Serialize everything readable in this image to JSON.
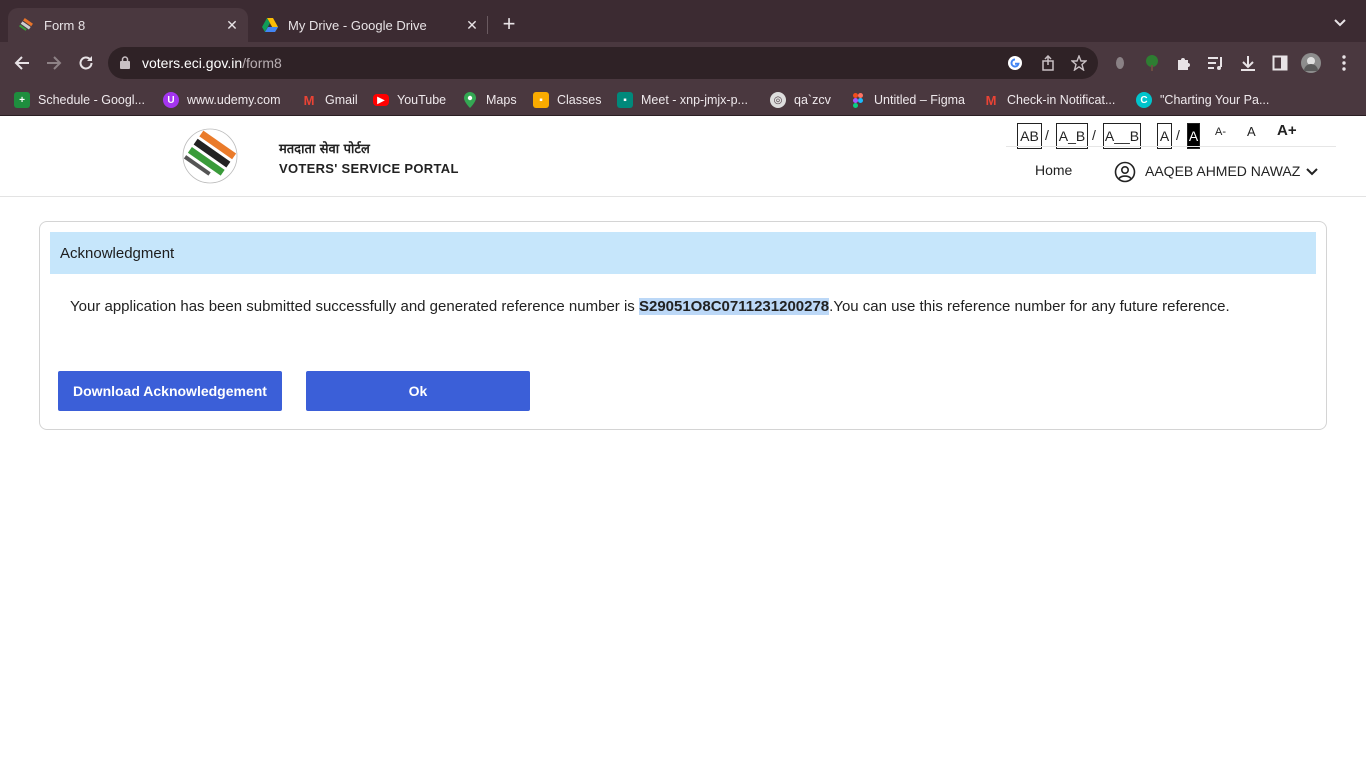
{
  "browser": {
    "tabs": [
      {
        "title": "Form 8",
        "favicon": "eci-favicon",
        "active": true
      },
      {
        "title": "My Drive - Google Drive",
        "favicon": "google-drive-icon",
        "active": false
      }
    ],
    "url": {
      "host": "voters.eci.gov.in",
      "path": "/form8"
    },
    "bookmarks": [
      {
        "label": "Schedule - Googl...",
        "icon": "google-sheets-icon",
        "color": "#1e8e3e"
      },
      {
        "label": "www.udemy.com",
        "icon": "udemy-icon",
        "color": "#a435f0"
      },
      {
        "label": "Gmail",
        "icon": "gmail-icon",
        "color": "#ea4335"
      },
      {
        "label": "YouTube",
        "icon": "youtube-icon",
        "color": "#ff0000"
      },
      {
        "label": "Maps",
        "icon": "maps-icon",
        "color": "#34a853"
      },
      {
        "label": "Classes",
        "icon": "classroom-icon",
        "color": "#f9ab00"
      },
      {
        "label": "Meet - xnp-jmjx-p...",
        "icon": "meet-icon",
        "color": "#00897b"
      },
      {
        "label": "qa`zcv",
        "icon": "globe-icon",
        "color": "#dddddd"
      },
      {
        "label": "Untitled – Figma",
        "icon": "figma-icon",
        "color": "#f24e1e"
      },
      {
        "label": "Check-in Notificat...",
        "icon": "gmail-icon",
        "color": "#ea4335"
      },
      {
        "label": "\"Charting Your Pa...",
        "icon": "canva-icon",
        "color": "#00c4cc"
      }
    ]
  },
  "site": {
    "brand_hindi": "मतदाता सेवा पोर्टल",
    "brand_english": "VOTERS' SERVICE PORTAL",
    "accessibility": {
      "spacing": [
        "AB",
        "A_B",
        "A__B"
      ],
      "contrast": [
        "A",
        "A"
      ],
      "font_sizes": [
        "A-",
        "A",
        "A+"
      ]
    },
    "nav": {
      "home": "Home",
      "user_name": "AAQEB AHMED NAWAZ"
    }
  },
  "acknowledgment": {
    "title": "Acknowledgment",
    "message_before": "Your application has been submitted successfully and generated reference number is ",
    "reference_number": "S29051O8C0711231200278",
    "message_after": ".You can use this reference number for any future reference.",
    "download_button": "Download Acknowledgement",
    "ok_button": "Ok"
  },
  "colors": {
    "primary_button": "#3b5fd8",
    "card_header": "#c6e6fb",
    "chrome_dark": "#3c2b32",
    "chrome_toolbar": "#4a383f"
  }
}
